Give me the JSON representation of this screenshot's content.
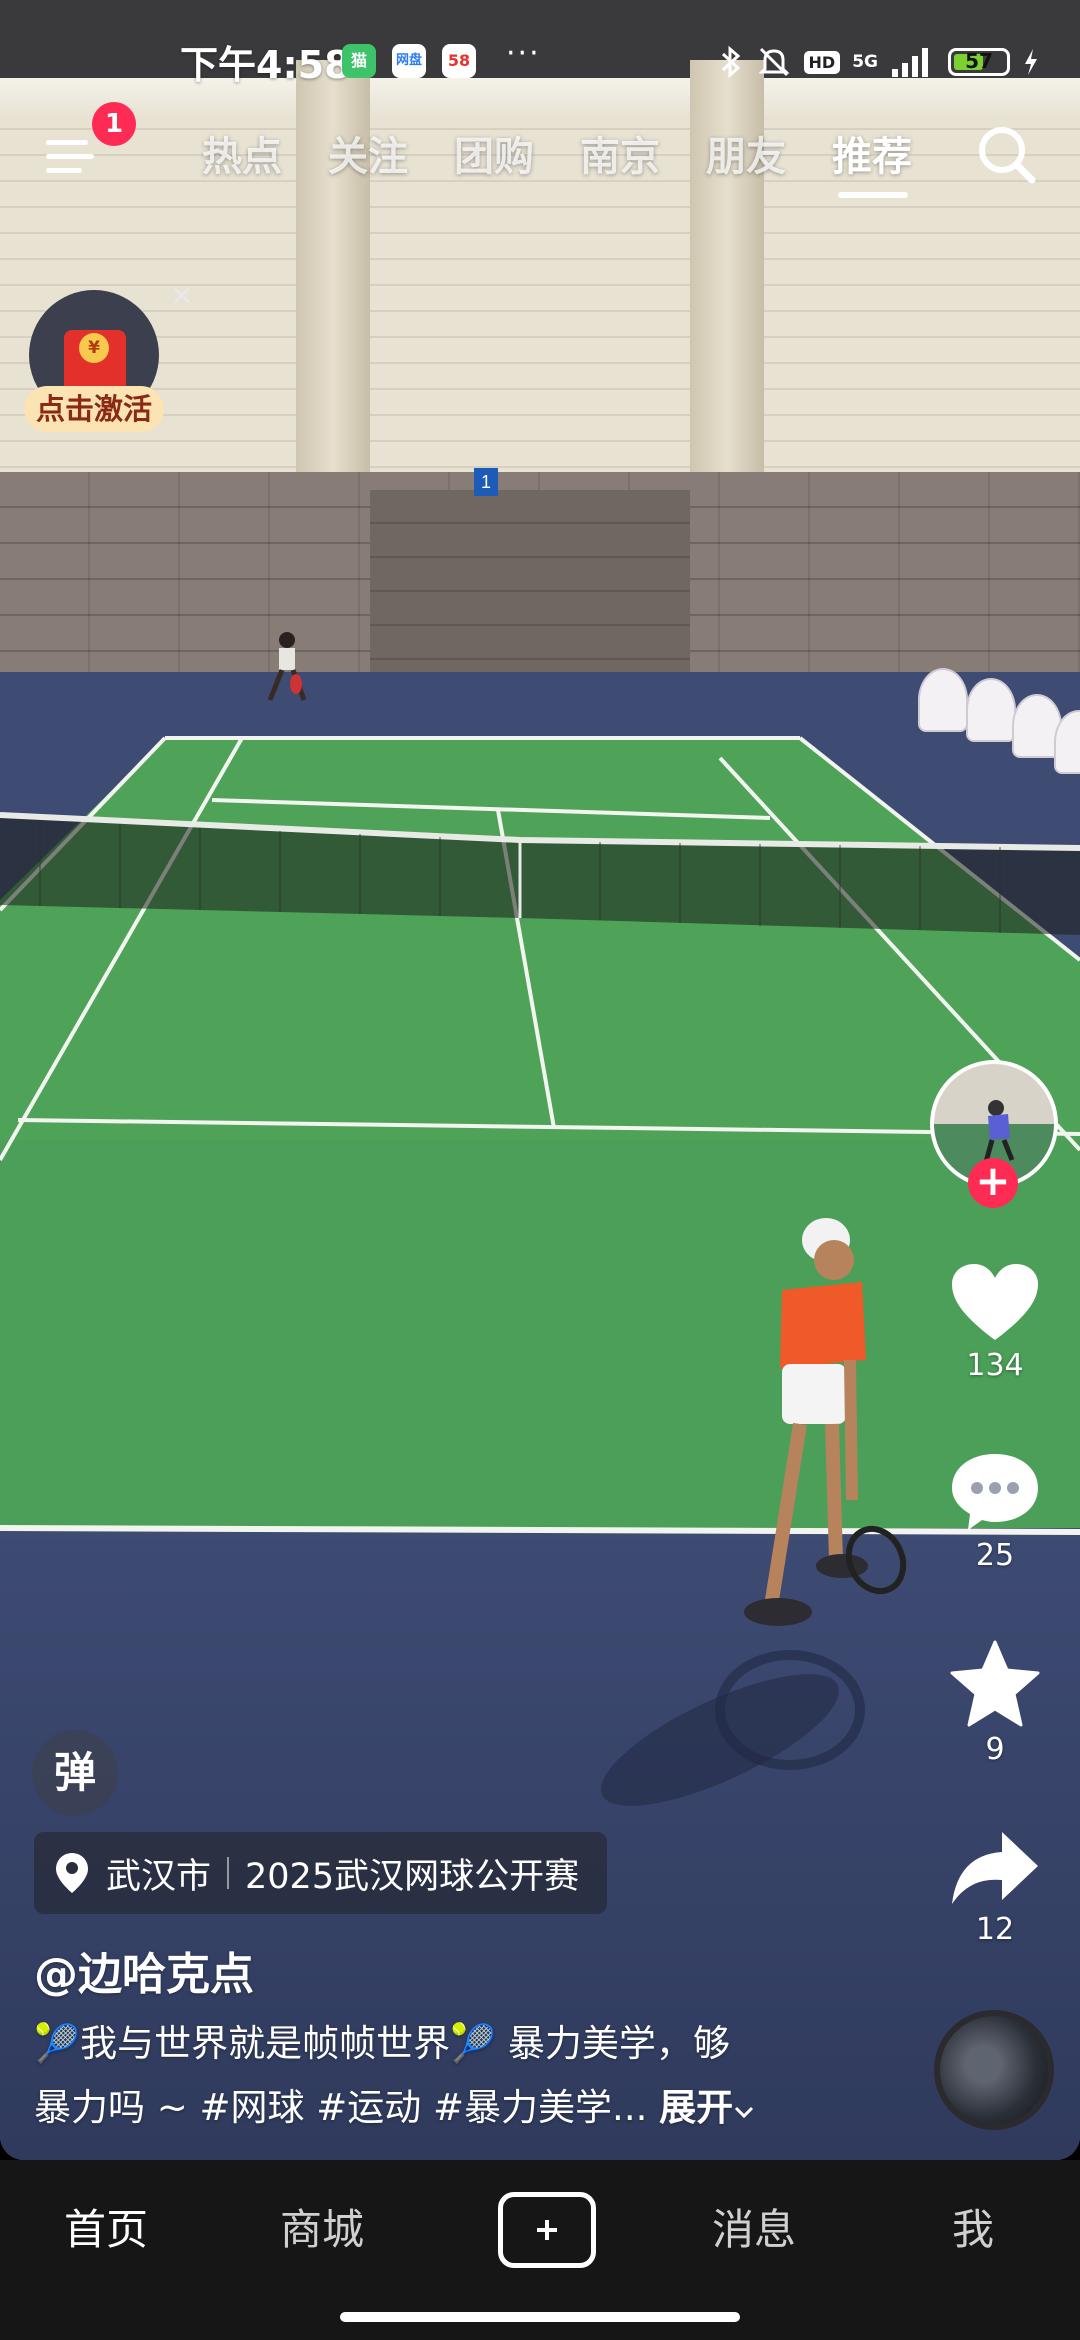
{
  "status_bar": {
    "time": "下午4:58",
    "app_badges": [
      "猫",
      "网盘",
      "58"
    ],
    "more": "···",
    "hd": "HD",
    "network": "5G",
    "battery": "57",
    "battery_level": 0.57
  },
  "top_nav": {
    "notification_count": "1",
    "tabs": [
      "热点",
      "关注",
      "团购",
      "南京",
      "朋友",
      "推荐"
    ],
    "active_tab": "推荐"
  },
  "activation_widget": {
    "label": "点击激活",
    "close": "×",
    "coin": "¥"
  },
  "court": {
    "court_number": "1"
  },
  "actions": {
    "likes": "134",
    "comments": "25",
    "favorites": "9",
    "shares": "12",
    "follow": "+"
  },
  "video_info": {
    "danmaku": "弹",
    "location_city": "武汉市",
    "location_event": "2025武汉网球公开赛",
    "author": "@边哈克点",
    "description_line1": "🎾我与世界就是帧帧世界🎾 暴力美学，够",
    "description_line2": "暴力吗 ~ #网球 #运动 #暴力美学...",
    "expand": "展开"
  },
  "bottom_tabs": {
    "home": "首页",
    "mall": "商城",
    "messages": "消息",
    "me": "我"
  },
  "colors": {
    "accent_red": "#fe2c55",
    "court_green": "#4fa358",
    "floor_blue": "#3e4b72",
    "tabbar_bg": "#161616"
  }
}
